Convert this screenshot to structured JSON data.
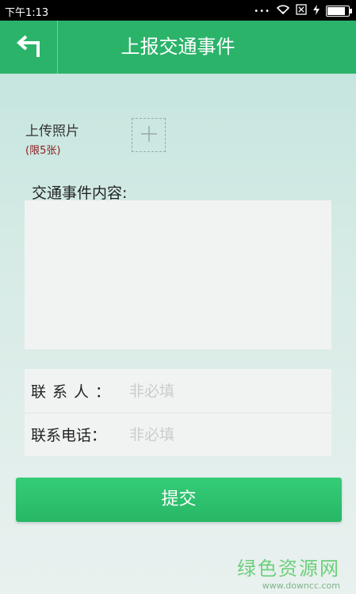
{
  "statusbar": {
    "time": "下午1:13",
    "battery_level": 0.85
  },
  "header": {
    "title": "上报交通事件",
    "colors": {
      "primary": "#2bb36a"
    }
  },
  "upload": {
    "label": "上传照片",
    "limit": "(限5张)"
  },
  "content": {
    "label": "交通事件内容:",
    "value": ""
  },
  "form": {
    "contact_label": "联系人：",
    "contact_placeholder": "非必填",
    "phone_label": "联系电话：",
    "phone_placeholder": "非必填"
  },
  "submit": {
    "label": "提交"
  },
  "watermark": {
    "title": "绿色资源网",
    "url": "www.downcc.com"
  }
}
